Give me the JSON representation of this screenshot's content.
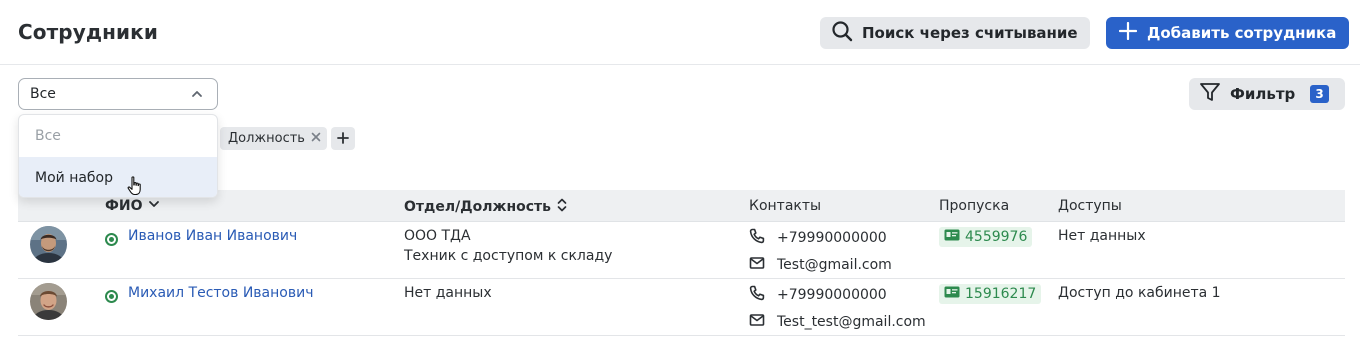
{
  "header": {
    "title": "Сотрудники",
    "scan_button": "Поиск через считывание",
    "add_button": "Добавить сотрудника"
  },
  "select": {
    "value": "Все",
    "options": [
      "Все",
      "Мой набор"
    ],
    "hovered_option": "Мой набор"
  },
  "filter": {
    "label": "Фильтр",
    "count": "3"
  },
  "chips": [
    {
      "label": "Должность"
    }
  ],
  "table": {
    "columns": {
      "name": "ФИО",
      "department": "Отдел/Должность",
      "contacts": "Контакты",
      "passes": "Пропуска",
      "access": "Доступы"
    },
    "rows": [
      {
        "name": "Иванов Иван Иванович",
        "department": "ООО ТДА",
        "position": "Техник с доступом к складу",
        "phone": "+79990000000",
        "email": "Test@gmail.com",
        "pass": "4559976",
        "access": "Нет данных"
      },
      {
        "name": "Михаил Тестов Иванович",
        "department": "Нет данных",
        "position": "",
        "phone": "+79990000000",
        "email": "Test_test@gmail.com",
        "pass": "15916217",
        "access": "Доступ до кабинета 1"
      }
    ]
  },
  "colors": {
    "accent": "#2a62c9",
    "link": "#2a5bb5",
    "status_active": "#2d8a4e",
    "pass_badge_bg": "#e6f4ea"
  },
  "icons": {
    "scan": "search-icon",
    "add": "plus-icon",
    "filter": "funnel-icon",
    "phone": "phone-icon",
    "email": "mail-icon",
    "pass": "id-card-icon"
  }
}
